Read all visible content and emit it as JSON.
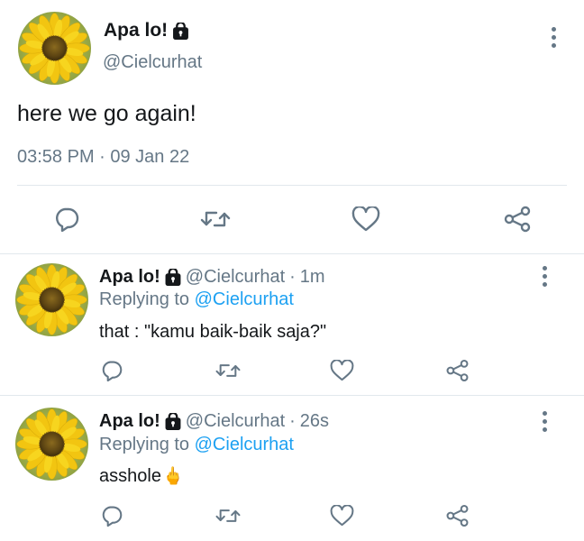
{
  "colors": {
    "text": "#14171a",
    "muted": "#657786",
    "link": "#1da1f2",
    "divider": "#e1e8ed"
  },
  "main_tweet": {
    "display_name": "Apa lo!",
    "handle": "@Cielcurhat",
    "text": "here we go again!",
    "timestamp": "03:58 PM · 09 Jan 22",
    "actions": [
      "reply-icon",
      "retweet-icon",
      "like-icon",
      "share-icon"
    ]
  },
  "replies": [
    {
      "display_name": "Apa lo!",
      "handle": "@Cielcurhat",
      "separator": "·",
      "time": "1m",
      "replying_prefix": "Replying to",
      "replying_to": "@Cielcurhat",
      "text": "that : \"kamu baik-baik saja?\"",
      "emoji": ""
    },
    {
      "display_name": "Apa lo!",
      "handle": "@Cielcurhat",
      "separator": "·",
      "time": "26s",
      "replying_prefix": "Replying to",
      "replying_to": "@Cielcurhat",
      "text": "asshole",
      "emoji": "🖕"
    }
  ]
}
